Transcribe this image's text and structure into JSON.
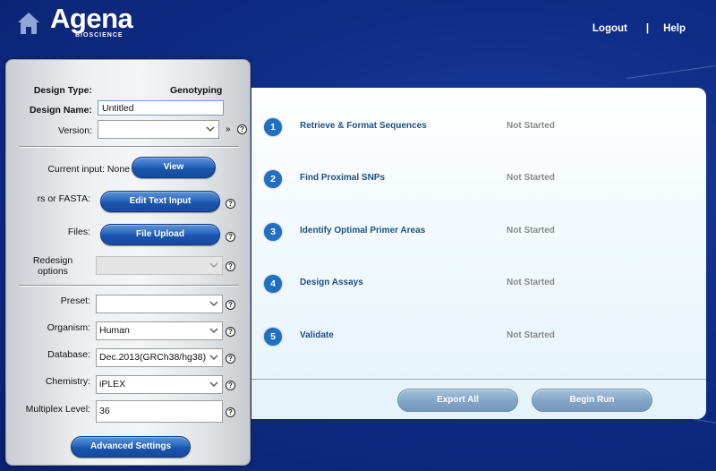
{
  "header": {
    "logo_text": "Agena",
    "logo_sub": "BIOSCIENCE",
    "logout_label": "Logout",
    "separator": "|",
    "help_label": "Help"
  },
  "design": {
    "type_label": "Design Type:",
    "type_value": "Genotyping",
    "name_label": "Design Name:",
    "name_value": "Untitled",
    "version_label": "Version:",
    "version_value": ""
  },
  "inputs": {
    "current_input_label": "Current input:",
    "current_input_value": "None",
    "view_label": "View",
    "rs_fasta_label": "rs or FASTA:",
    "edit_text_label": "Edit Text Input",
    "files_label": "Files:",
    "file_upload_label": "File Upload",
    "redesign_label_1": "Redesign",
    "redesign_label_2": "options"
  },
  "settings": {
    "preset_label": "Preset:",
    "preset_value": "",
    "organism_label": "Organism:",
    "organism_value": "Human",
    "database_label": "Database:",
    "database_value": "Dec.2013(GRCh38/hg38)",
    "chemistry_label": "Chemistry:",
    "chemistry_value": "iPLEX",
    "multiplex_label": "Multiplex Level:",
    "multiplex_value": "36",
    "advanced_label": "Advanced Settings"
  },
  "help_glyph": "?",
  "arrow_glyph": "»",
  "steps": [
    {
      "num": "1",
      "label": "Retrieve & Format Sequences",
      "status": "Not Started"
    },
    {
      "num": "2",
      "label": "Find Proximal SNPs",
      "status": "Not Started"
    },
    {
      "num": "3",
      "label": "Identify Optimal Primer Areas",
      "status": "Not Started"
    },
    {
      "num": "4",
      "label": "Design Assays",
      "status": "Not Started"
    },
    {
      "num": "5",
      "label": "Validate",
      "status": "Not Started"
    }
  ],
  "actions": {
    "export_all_label": "Export All",
    "begin_run_label": "Begin Run"
  },
  "colors": {
    "background": "#0f2d86",
    "accent_blue": "#1f6fc2",
    "step_label": "#1f4e86",
    "status_gray": "#8a8a8a"
  }
}
